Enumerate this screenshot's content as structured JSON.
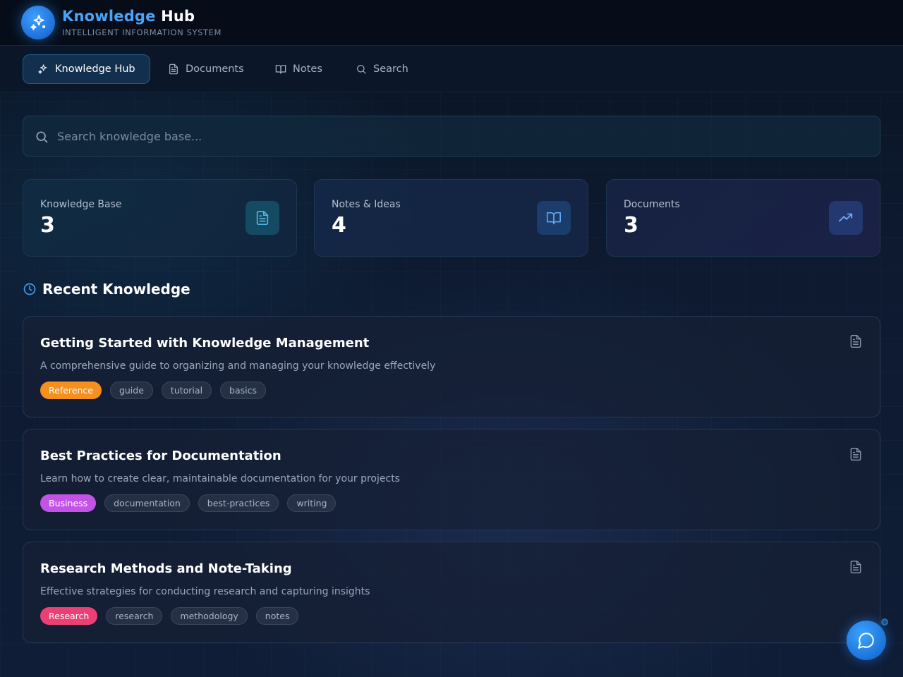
{
  "header": {
    "title_accent": "Knowledge",
    "title_rest": " Hub",
    "subtitle": "INTELLIGENT INFORMATION SYSTEM",
    "logo_icon": "sparkles-icon"
  },
  "nav": {
    "tabs": [
      {
        "label": "Knowledge Hub",
        "icon": "sparkles-icon",
        "active": true
      },
      {
        "label": "Documents",
        "icon": "document-icon",
        "active": false
      },
      {
        "label": "Notes",
        "icon": "book-open-icon",
        "active": false
      },
      {
        "label": "Search",
        "icon": "search-icon",
        "active": false
      }
    ]
  },
  "search": {
    "placeholder": "Search knowledge base...",
    "value": ""
  },
  "stats": [
    {
      "label": "Knowledge Base",
      "value": "3",
      "icon": "document-icon",
      "color": "#4fb8e6"
    },
    {
      "label": "Notes & Ideas",
      "value": "4",
      "icon": "book-open-icon",
      "color": "#5fa8f0"
    },
    {
      "label": "Documents",
      "value": "3",
      "icon": "trending-up-icon",
      "color": "#6e9cf5"
    }
  ],
  "recent": {
    "title": "Recent Knowledge",
    "icon": "clock-icon",
    "items": [
      {
        "title": "Getting Started with Knowledge Management",
        "description": "A comprehensive guide to organizing and managing your knowledge effectively",
        "category": "Reference",
        "category_color": "#f5901e",
        "tags": [
          "guide",
          "tutorial",
          "basics"
        ]
      },
      {
        "title": "Best Practices for Documentation",
        "description": "Learn how to create clear, maintainable documentation for your projects",
        "category": "Business",
        "category_color": "#c452e6",
        "tags": [
          "documentation",
          "best-practices",
          "writing"
        ]
      },
      {
        "title": "Research Methods and Note-Taking",
        "description": "Effective strategies for conducting research and capturing insights",
        "category": "Research",
        "category_color": "#ec3f74",
        "tags": [
          "research",
          "methodology",
          "notes"
        ]
      }
    ]
  },
  "chat": {
    "icon": "chat-bubble-icon"
  },
  "colors": {
    "accent": "#4ba3f5",
    "background": "#0d1a30"
  }
}
